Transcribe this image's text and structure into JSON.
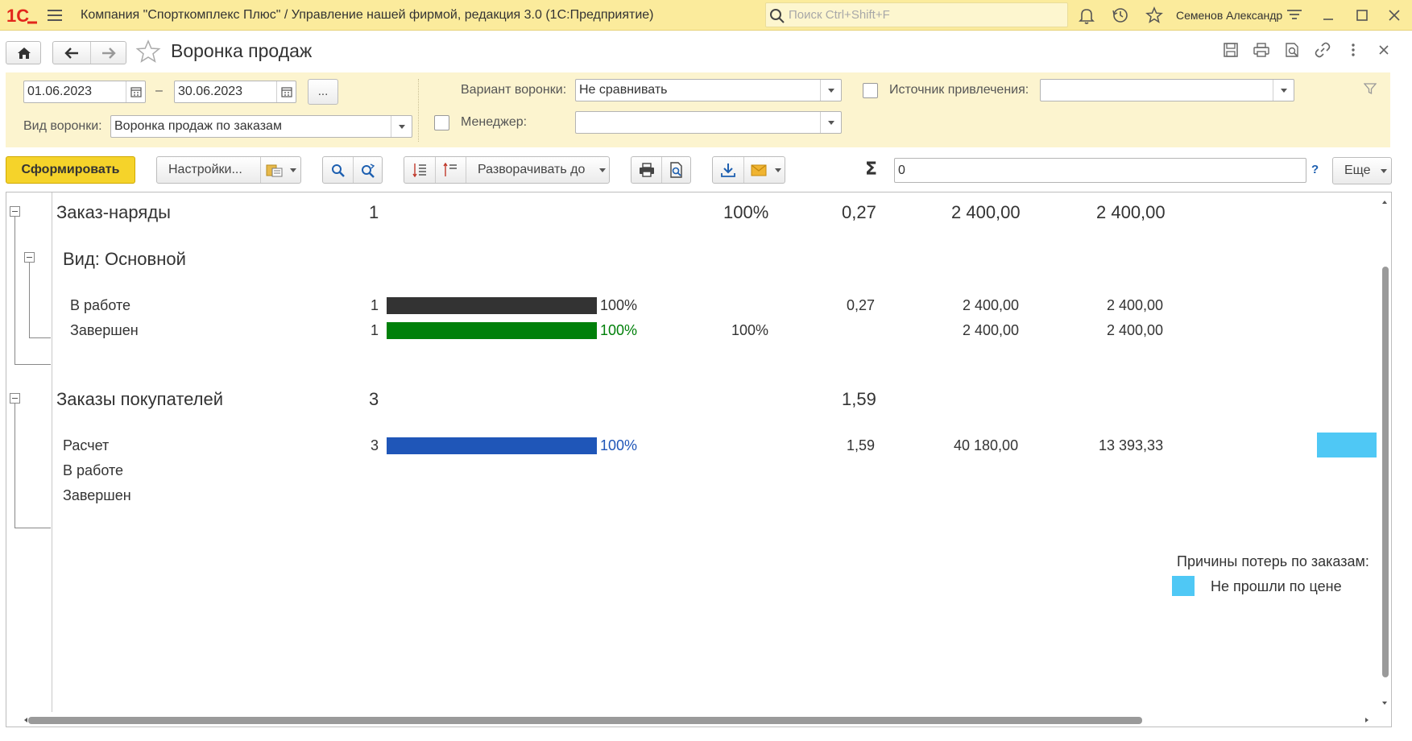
{
  "app": {
    "window_title": "Компания \"Спорткомплекс Плюс\" / Управление нашей фирмой, редакция 3.0  (1С:Предприятие)",
    "search_placeholder": "Поиск Ctrl+Shift+F",
    "user_name": "Семенов Александр"
  },
  "form": {
    "title": "Воронка продаж"
  },
  "filters": {
    "date_from": "01.06.2023",
    "date_dash": "–",
    "date_to": "30.06.2023",
    "period_button": "...",
    "funnel_type_label": "Вид воронки:",
    "funnel_type_value": "Воронка продаж по заказам",
    "funnel_variant_label": "Вариант воронки:",
    "funnel_variant_value": "Не сравнивать",
    "manager_label": "Менеджер:",
    "manager_value": "",
    "source_label": "Источник привлечения:",
    "source_value": ""
  },
  "toolbar": {
    "generate_label": "Сформировать",
    "settings_label": "Настройки...",
    "expand_label": "Разворачивать до",
    "sum_value": "0",
    "help_label": "?",
    "more_label": "Еще"
  },
  "report": {
    "groups": [
      {
        "name": "Заказ-наряды",
        "count": "1",
        "percent": "100%",
        "ratio": "0,27",
        "sum1": "2 400,00",
        "sum2": "2 400,00",
        "subgroup": "Вид: Основной",
        "rows": [
          {
            "name": "В работе",
            "count": "1",
            "bar_percent": "100%",
            "bar_fill": 1.0,
            "conv": "",
            "ratio": "0,27",
            "sum1": "2 400,00",
            "sum2": "2 400,00"
          },
          {
            "name": "Завершен",
            "count": "1",
            "bar_percent": "100%",
            "bar_fill": 1.0,
            "conv": "100%",
            "ratio": "",
            "sum1": "2 400,00",
            "sum2": "2 400,00"
          }
        ]
      },
      {
        "name": "Заказы покупателей",
        "count": "3",
        "percent": "",
        "ratio": "1,59",
        "sum1": "",
        "sum2": "",
        "rows": [
          {
            "name": "Расчет",
            "count": "3",
            "bar_percent": "100%",
            "bar_fill": 1.0,
            "conv": "",
            "ratio": "1,59",
            "sum1": "40 180,00",
            "sum2": "13 393,33"
          },
          {
            "name": "В работе"
          },
          {
            "name": "Завершен"
          }
        ]
      }
    ],
    "legend_title": "Причины потерь по заказам:",
    "legend_item": "Не прошли по цене"
  },
  "colors": {
    "titlebar": "#fbeb9c",
    "filters_bg": "#fcf4cf",
    "generate_button": "#f5d32a",
    "bar_in_work": "#333333",
    "bar_done": "#00800a",
    "bar_payment": "#1f56b8",
    "loss_reason": "#4fc8f5",
    "logo_red": "#e2261b"
  }
}
